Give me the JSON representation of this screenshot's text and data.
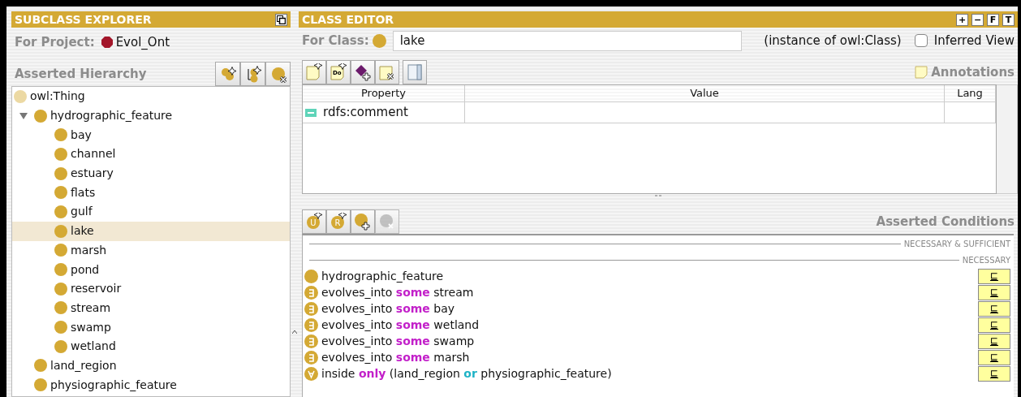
{
  "explorer": {
    "title": "SUBCLASS EXPLORER",
    "project_label": "For Project:",
    "project": "Evol_Ont",
    "hierarchy_label": "Asserted Hierarchy",
    "tools": [
      {
        "kind": "add_sibling"
      },
      {
        "kind": "add_subclass"
      },
      {
        "kind": "delete"
      }
    ],
    "tree": [
      {
        "label": "owl:Thing",
        "selected": false,
        "children": [
          {
            "label": "hydrographic_feature",
            "selected": false,
            "expanded": true,
            "children": [
              {
                "label": "bay",
                "selected": false
              },
              {
                "label": "channel",
                "selected": false
              },
              {
                "label": "estuary",
                "selected": false
              },
              {
                "label": "flats",
                "selected": false
              },
              {
                "label": "gulf",
                "selected": false
              },
              {
                "label": "lake",
                "selected": true
              },
              {
                "label": "marsh",
                "selected": false
              },
              {
                "label": "pond",
                "selected": false
              },
              {
                "label": "reservoir",
                "selected": false
              },
              {
                "label": "stream",
                "selected": false
              },
              {
                "label": "swamp",
                "selected": false
              },
              {
                "label": "wetland",
                "selected": false
              }
            ]
          },
          {
            "label": "land_region",
            "selected": false
          },
          {
            "label": "physiographic_feature",
            "selected": false
          }
        ]
      }
    ]
  },
  "editor": {
    "title": "CLASS EDITOR",
    "header_buttons": [
      "+",
      "−",
      "F",
      "T"
    ],
    "class_label": "For Class:",
    "class_name": "lake",
    "instance_of": "(instance of owl:Class)",
    "inferred_view": {
      "label": "Inferred View",
      "checked": false
    },
    "annotation_tools": [
      {
        "kind": "note_create"
      },
      {
        "kind": "note_create",
        "glyph": "Do"
      },
      {
        "kind": "property_add"
      },
      {
        "kind": "note_remove"
      },
      {
        "kind": "columns"
      }
    ],
    "annotations_label": "Annotations",
    "table": {
      "columns": [
        "Property",
        "Value",
        "Lang"
      ],
      "rows": [
        {
          "property": "rdfs:comment"
        }
      ]
    },
    "condition_tools": [
      {
        "kind": "create",
        "glyph": "U",
        "disabled": false
      },
      {
        "kind": "create",
        "glyph": "R",
        "disabled": false
      },
      {
        "kind": "add",
        "disabled": false
      },
      {
        "kind": "remove",
        "disabled": true
      }
    ],
    "conditions_label": "Asserted Conditions",
    "sections": [
      {
        "title": "NECESSARY & SUFFICIENT"
      },
      {
        "title": "NECESSARY",
        "conditions": [
          {
            "kind": "named_class",
            "button": "⊑",
            "parts": [
              {
                "kind": "name",
                "text": "hydrographic_feature"
              }
            ]
          },
          {
            "kind": "existential",
            "button": "⊑",
            "parts": [
              {
                "kind": "name",
                "text": "evolves_into "
              },
              {
                "kind": "keyword",
                "text": "some"
              },
              {
                "kind": "name",
                "text": " stream"
              }
            ]
          },
          {
            "kind": "existential",
            "button": "⊑",
            "parts": [
              {
                "kind": "name",
                "text": "evolves_into "
              },
              {
                "kind": "keyword",
                "text": "some"
              },
              {
                "kind": "name",
                "text": " bay"
              }
            ]
          },
          {
            "kind": "existential",
            "button": "⊑",
            "parts": [
              {
                "kind": "name",
                "text": "evolves_into "
              },
              {
                "kind": "keyword",
                "text": "some"
              },
              {
                "kind": "name",
                "text": " wetland"
              }
            ]
          },
          {
            "kind": "existential",
            "button": "⊑",
            "parts": [
              {
                "kind": "name",
                "text": "evolves_into "
              },
              {
                "kind": "keyword",
                "text": "some"
              },
              {
                "kind": "name",
                "text": " swamp"
              }
            ]
          },
          {
            "kind": "existential",
            "button": "⊑",
            "parts": [
              {
                "kind": "name",
                "text": "evolves_into "
              },
              {
                "kind": "keyword",
                "text": "some"
              },
              {
                "kind": "name",
                "text": " marsh"
              }
            ]
          },
          {
            "kind": "universal",
            "button": "⊑",
            "parts": [
              {
                "kind": "name",
                "text": "inside "
              },
              {
                "kind": "keyword",
                "text": "only"
              },
              {
                "kind": "name",
                "text": " (land_region "
              },
              {
                "kind": "operator",
                "text": "or"
              },
              {
                "kind": "name",
                "text": " physiographic_feature)"
              }
            ]
          }
        ]
      }
    ]
  }
}
